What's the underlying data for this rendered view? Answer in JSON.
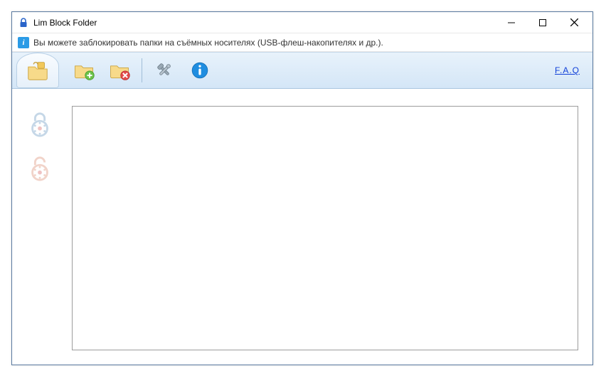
{
  "titlebar": {
    "title": "Lim Block Folder"
  },
  "infobar": {
    "message": "Вы можете заблокировать папки на съёмных носителях (USB-флеш-накопителях и др.)."
  },
  "toolbar": {
    "faq_label": "F.A.Q"
  }
}
